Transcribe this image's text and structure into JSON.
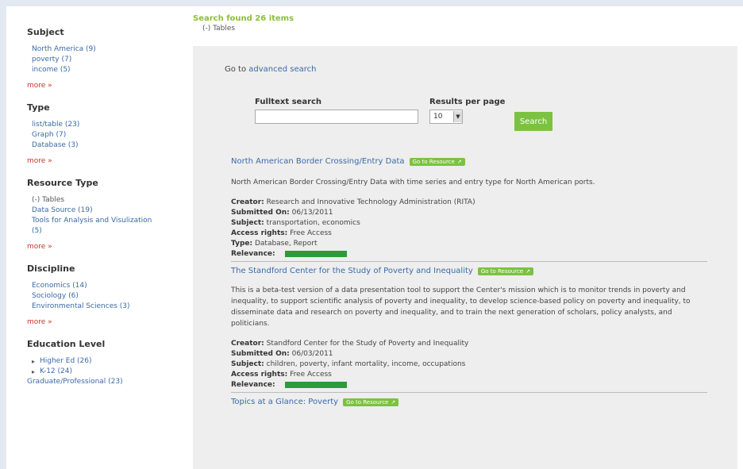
{
  "status": {
    "found": "Search found 26 items",
    "filter": "(-) Tables"
  },
  "sidebar": {
    "subject": {
      "title": "Subject",
      "items": [
        "North America (9)",
        "poverty (7)",
        "income (5)"
      ],
      "more": "more »"
    },
    "type": {
      "title": "Type",
      "items": [
        "list/table (23)",
        "Graph (7)",
        "Database (3)"
      ],
      "more": "more »"
    },
    "resource_type": {
      "title": "Resource Type",
      "selected": "(-) Tables",
      "items": [
        "Data Source (19)",
        "Tools for Analysis and Visulization",
        "(5)"
      ],
      "more": "more »"
    },
    "discipline": {
      "title": "Discipline",
      "items": [
        "Economics (14)",
        "Sociology (6)",
        "Environmental Sciences (3)"
      ],
      "more": "more »"
    },
    "education_level": {
      "title": "Education Level",
      "items": [
        "Higher Ed (26)",
        "K-12 (24)"
      ],
      "extra": "Graduate/Professional (23)"
    }
  },
  "search": {
    "advanced_prefix": "Go to ",
    "advanced_link": "advanced search",
    "fulltext_label": "Fulltext search",
    "fulltext_value": "",
    "rpp_label": "Results per page",
    "rpp_value": "10",
    "button": "Search"
  },
  "results": [
    {
      "title": "North American Border Crossing/Entry Data",
      "goto": "Go to Resource",
      "description": "North American Border Crossing/Entry Data with time series and entry type for North American ports.",
      "creator_label": "Creator:",
      "creator": "Research and Innovative Technology Administration (RITA)",
      "submitted_label": "Submitted On:",
      "submitted": "06/13/2011",
      "subject_label": "Subject:",
      "subject": "transportation, economics",
      "access_label": "Access rights:",
      "access": "Free Access",
      "type_label": "Type:",
      "type": "Database, Report",
      "relevance_label": "Relevance:"
    },
    {
      "title": "The Standford Center for the Study of Poverty and Inequality",
      "goto": "Go to Resource",
      "description": "This is a beta-test version of a data presentation tool to support the Center's mission which is to monitor trends in poverty and inequality, to support scientific analysis of poverty and inequality, to develop science-based policy on poverty and inequality, to disseminate data and research on poverty and inequality, and to train the next generation of scholars, policy analysts, and politicians.",
      "creator_label": "Creator:",
      "creator": "Standford Center for the Study of Poverty and Inequality",
      "submitted_label": "Submitted On:",
      "submitted": "06/03/2011",
      "subject_label": "Subject:",
      "subject": "children, poverty, infant mortality, income, occupations",
      "access_label": "Access rights:",
      "access": "Free Access",
      "relevance_label": "Relevance:"
    },
    {
      "title": "Topics at a Glance: Poverty",
      "goto": "Go to Resource"
    }
  ],
  "colors": {
    "link": "#3a6aa6",
    "accent_green": "#7bc241",
    "more_red": "#c0392b",
    "relevance": "#2b9c3a"
  }
}
